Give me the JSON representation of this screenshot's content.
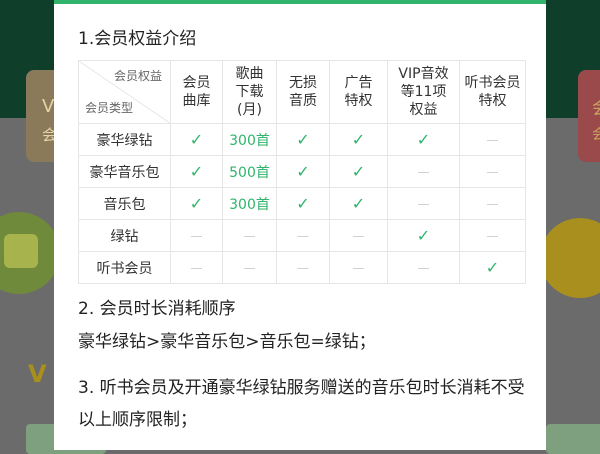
{
  "background": {
    "card_left_title": "V",
    "card_left_sub": "会",
    "card_right_title": "会",
    "card_right_sub": "会",
    "v_label": "V"
  },
  "colors": {
    "accent": "#31b36b",
    "dash": "#cccccc"
  },
  "modal": {
    "section1_title": "1.会员权益介绍",
    "table": {
      "corner_top": "会员权益",
      "corner_bottom": "会员类型",
      "columns": [
        "会员\n曲库",
        "歌曲\n下载\n(月)",
        "无损\n音质",
        "广告\n特权",
        "VIP音效\n等11项\n权益",
        "听书会员\n特权"
      ],
      "rows": [
        {
          "type": "豪华绿钻",
          "cells": [
            "check",
            "300首",
            "check",
            "check",
            "check",
            "dash"
          ]
        },
        {
          "type": "豪华音乐包",
          "cells": [
            "check",
            "500首",
            "check",
            "check",
            "dash",
            "dash"
          ]
        },
        {
          "type": "音乐包",
          "cells": [
            "check",
            "300首",
            "check",
            "check",
            "dash",
            "dash"
          ]
        },
        {
          "type": "绿钻",
          "cells": [
            "dash",
            "dash",
            "dash",
            "dash",
            "check",
            "dash"
          ]
        },
        {
          "type": "听书会员",
          "cells": [
            "dash",
            "dash",
            "dash",
            "dash",
            "dash",
            "check"
          ]
        }
      ],
      "check_symbol": "✓",
      "dash_symbol": "—"
    },
    "section2_title": "2. 会员时长消耗顺序",
    "section2_text": "豪华绿钻>豪华音乐包>音乐包=绿钻；",
    "section3_text": "3. 听书会员及开通豪华绿钻服务赠送的音乐包时长消耗不受以上顺序限制；"
  }
}
